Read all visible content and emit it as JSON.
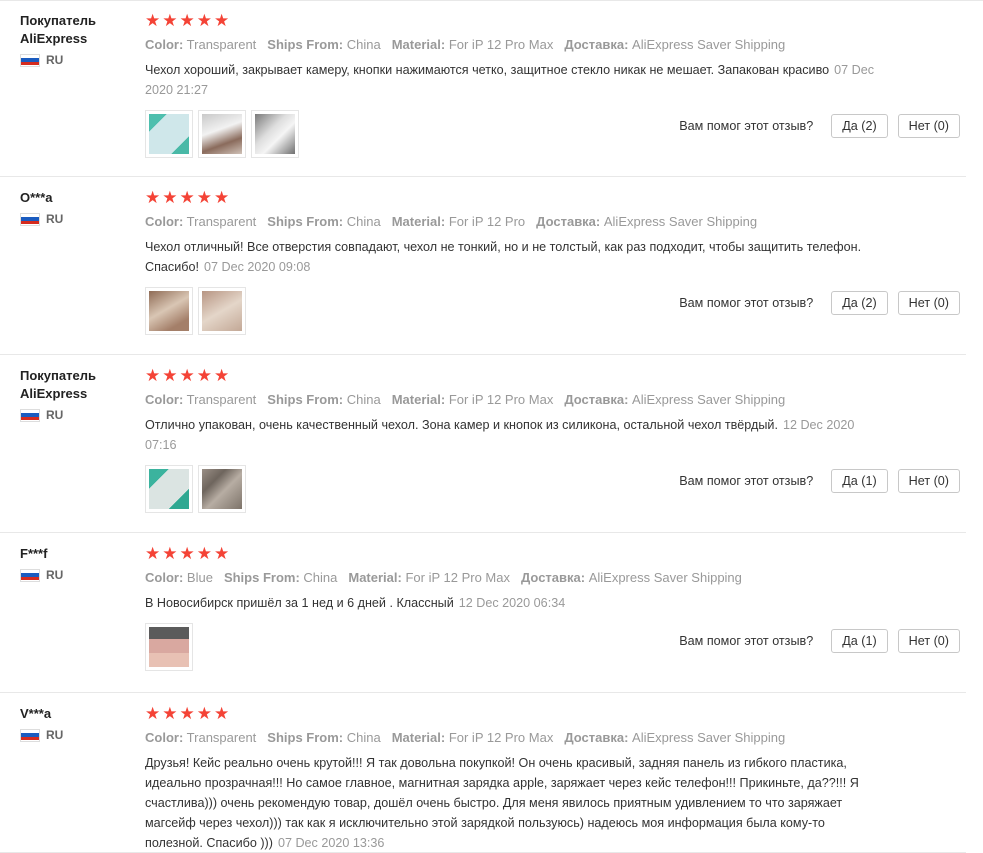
{
  "helpful_question": "Вам помог этот отзыв?",
  "reviews": [
    {
      "user": "Покупатель AliExpress",
      "country": "RU",
      "stars": 5,
      "props": [
        {
          "k": "Color:",
          "v": "Transparent"
        },
        {
          "k": "Ships From:",
          "v": "China"
        },
        {
          "k": "Material:",
          "v": "For iP 12 Pro Max"
        },
        {
          "k": "Доставка:",
          "v": "AliExpress Saver Shipping"
        }
      ],
      "text": "Чехол хороший, закрывает камеру, кнопки нажимаются четко, защитное стекло никак не мешает. Запакован красиво",
      "date": "07 Dec 2020 21:27",
      "photos": [
        "ph-teal",
        "ph-clear1",
        "ph-grey"
      ],
      "yes": "Да (2)",
      "no": "Нет (0)"
    },
    {
      "user": "O***a",
      "country": "RU",
      "stars": 5,
      "props": [
        {
          "k": "Color:",
          "v": "Transparent"
        },
        {
          "k": "Ships From:",
          "v": "China"
        },
        {
          "k": "Material:",
          "v": "For iP 12 Pro"
        },
        {
          "k": "Доставка:",
          "v": "AliExpress Saver Shipping"
        }
      ],
      "text": "Чехол отличный! Все отверстия совпадают, чехол не тонкий, но и не толстый, как раз подходит, чтобы защитить телефон. Спасибо!",
      "date": "07 Dec 2020 09:08",
      "photos": [
        "ph-tan1",
        "ph-tan2"
      ],
      "yes": "Да (2)",
      "no": "Нет (0)"
    },
    {
      "user": "Покупатель AliExpress",
      "country": "RU",
      "stars": 5,
      "props": [
        {
          "k": "Color:",
          "v": "Transparent"
        },
        {
          "k": "Ships From:",
          "v": "China"
        },
        {
          "k": "Material:",
          "v": "For iP 12 Pro Max"
        },
        {
          "k": "Доставка:",
          "v": "AliExpress Saver Shipping"
        }
      ],
      "text": "Отлично упакован, очень качественный чехол. Зона камер и кнопок из силикона, остальной чехол твёрдый.",
      "date": "12 Dec 2020 07:16",
      "photos": [
        "ph-teal2",
        "ph-stone"
      ],
      "yes": "Да (1)",
      "no": "Нет (0)"
    },
    {
      "user": "F***f",
      "country": "RU",
      "stars": 5,
      "props": [
        {
          "k": "Color:",
          "v": "Blue"
        },
        {
          "k": "Ships From:",
          "v": "China"
        },
        {
          "k": "Material:",
          "v": "For iP 12 Pro Max"
        },
        {
          "k": "Доставка:",
          "v": "AliExpress Saver Shipping"
        }
      ],
      "text": "В Новосибирск пришёл за 1 нед и 6 дней . Классный",
      "date": "12 Dec 2020 06:34",
      "photos": [
        "ph-pink"
      ],
      "yes": "Да (1)",
      "no": "Нет (0)"
    },
    {
      "user": "V***a",
      "country": "RU",
      "stars": 5,
      "props": [
        {
          "k": "Color:",
          "v": "Transparent"
        },
        {
          "k": "Ships From:",
          "v": "China"
        },
        {
          "k": "Material:",
          "v": "For iP 12 Pro Max"
        },
        {
          "k": "Доставка:",
          "v": "AliExpress Saver Shipping"
        }
      ],
      "text": "Друзья! Кейс реально очень крутой!!! Я так довольна покупкой! Он очень красивый, задняя панель из гибкого пластика, идеально прозрачная!!! Но самое главное, магнитная зарядка apple, заряжает через кейс телефон!!! Прикиньте, да??!!! Я счастлива))) очень рекомендую товар, дошёл очень быстро. Для меня явилось приятным удивлением то что заряжает магсейф через чехол))) так как я исключительно этой зарядкой пользуюсь) надеюсь моя информация была кому-то полезной. Спасибо )))",
      "date": "07 Dec 2020 13:36",
      "photos": [],
      "yes": "",
      "no": ""
    }
  ]
}
